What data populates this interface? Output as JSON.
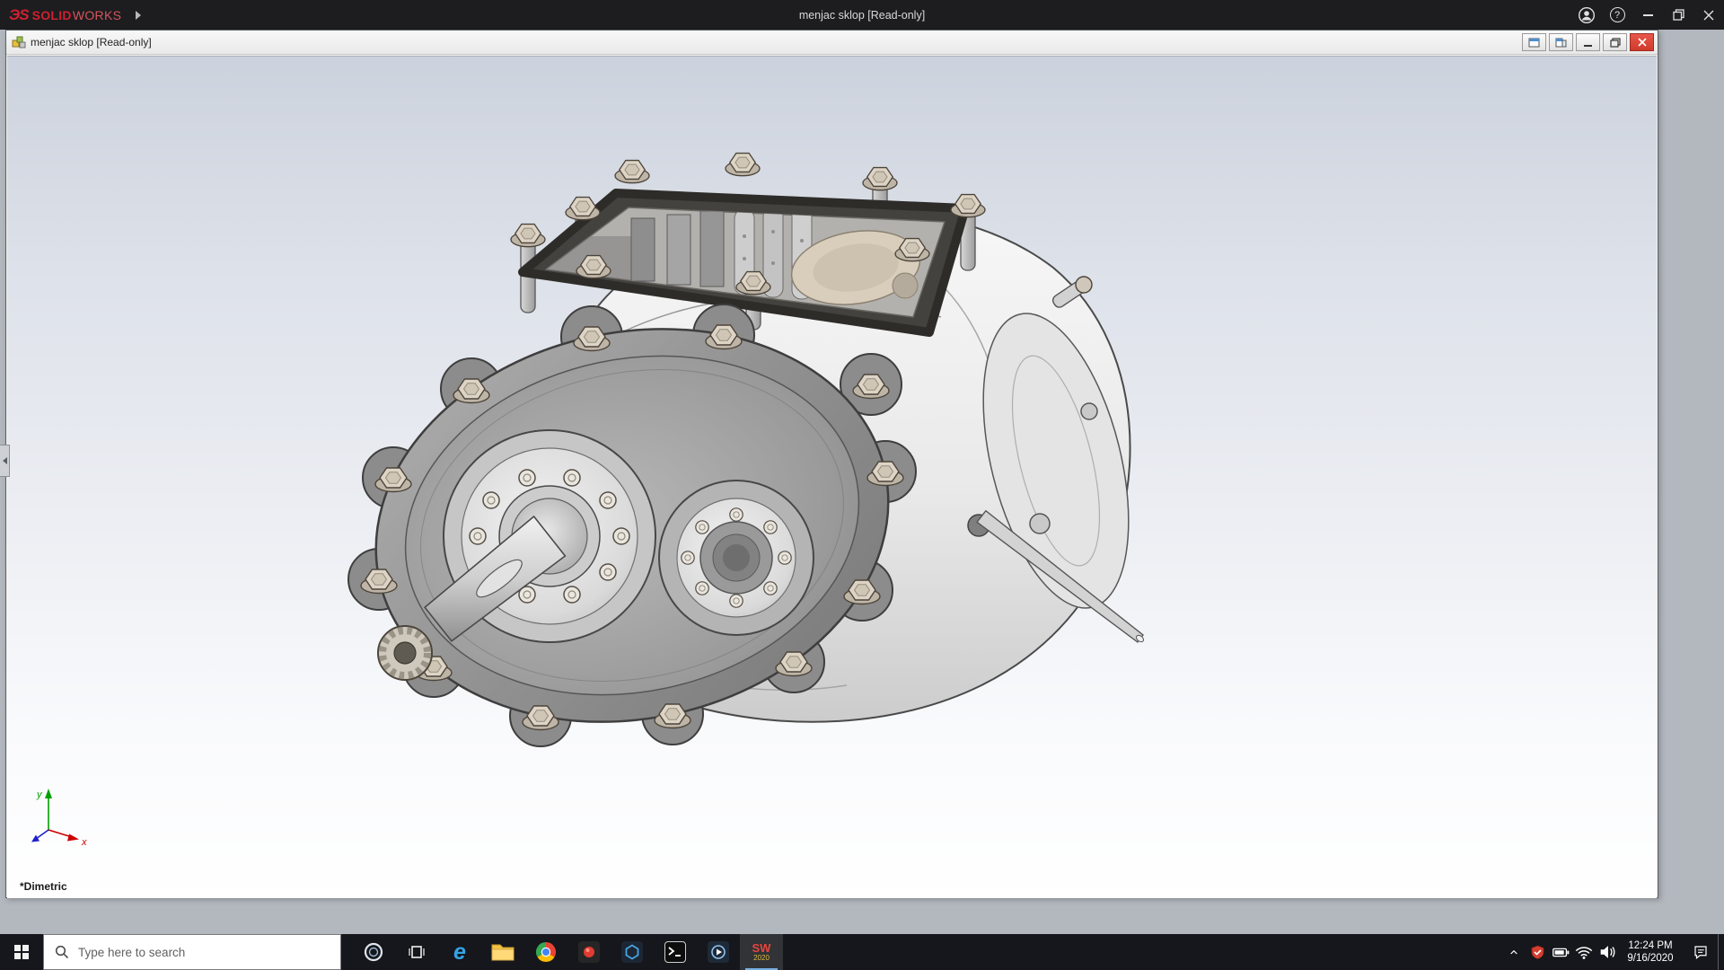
{
  "app_titlebar": {
    "logo_ds": "ЭS",
    "logo_solid": "SOLID",
    "logo_works": "WORKS",
    "title": "menjac sklop [Read-only]",
    "help_glyph": "?"
  },
  "document_window": {
    "title": "menjac sklop [Read-only]",
    "view_label": "*Dimetric",
    "triad": {
      "x": "x",
      "y": "y"
    }
  },
  "taskbar": {
    "search_placeholder": "Type here to search",
    "sw_icon_text": "SW",
    "sw_icon_year": "2020",
    "clock_time": "12:24 PM",
    "clock_date": "9/16/2020"
  },
  "icons": {
    "edge_glyph": "e"
  },
  "colors": {
    "brand_red": "#cf2030",
    "close_button_red": "#d03a2c",
    "viewport_gradient_top": "#ccd2dd",
    "taskbar_bg": "#15171c"
  }
}
